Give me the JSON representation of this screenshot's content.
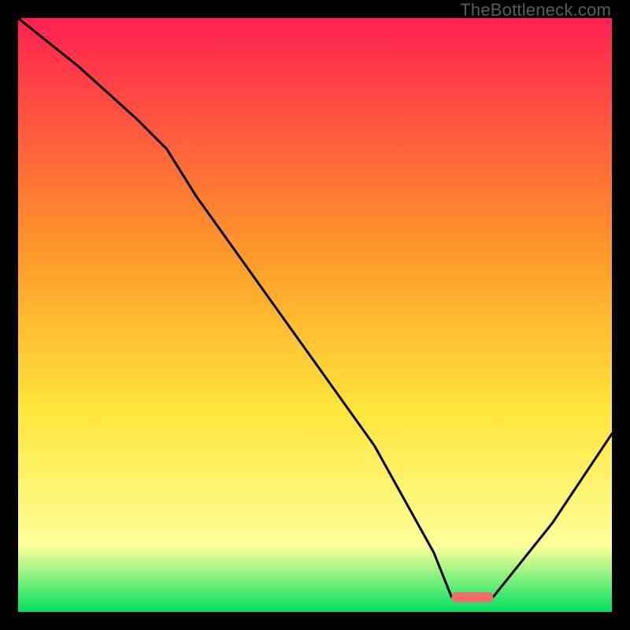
{
  "watermark": "TheBottleneck.com",
  "colors": {
    "frame": "#000000",
    "curve": "#000000",
    "marker": "#f06b69",
    "grad_top": "#ff2050",
    "grad_mid1": "#ff9a2a",
    "grad_mid2": "#ffe63a",
    "grad_mid3": "#fdff9a",
    "grad_bottom": "#00e060"
  },
  "chart_data": {
    "type": "line",
    "title": "",
    "xlabel": "",
    "ylabel": "",
    "xlim": [
      0,
      100
    ],
    "ylim": [
      0,
      100
    ],
    "annotations": [
      "TheBottleneck.com"
    ],
    "marker": {
      "x_start": 73,
      "x_end": 80,
      "y": 2.5
    },
    "series": [
      {
        "name": "bottleneck-curve",
        "x": [
          0,
          10,
          20,
          25,
          30,
          40,
          50,
          60,
          70,
          73,
          80,
          90,
          100
        ],
        "values": [
          100,
          92,
          83,
          78,
          70,
          56,
          42,
          28,
          10,
          2.5,
          2.5,
          15,
          30
        ]
      }
    ]
  }
}
